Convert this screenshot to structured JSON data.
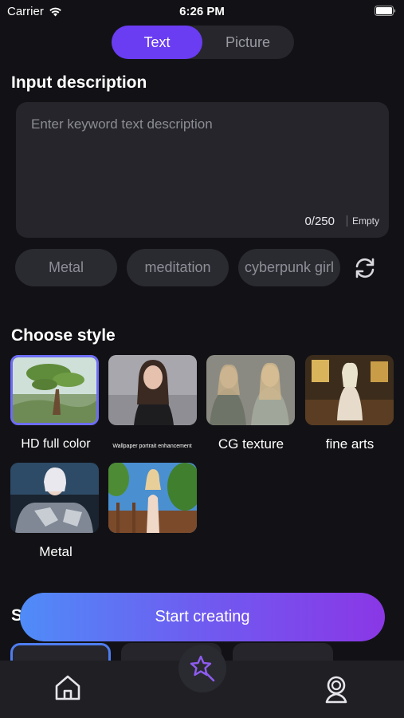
{
  "status": {
    "carrier": "Carrier",
    "time": "6:26 PM"
  },
  "mode_tabs": [
    {
      "label": "Text",
      "selected": true
    },
    {
      "label": "Picture",
      "selected": false
    }
  ],
  "input": {
    "title": "Input description",
    "placeholder": "Enter keyword text description",
    "counter": "0/250",
    "empty_label": "Empty"
  },
  "keyword_chips": [
    "Metal",
    "meditation",
    "cyberpunk girl"
  ],
  "style": {
    "title": "Choose style",
    "items": [
      {
        "label": "HD full color",
        "selected": true
      },
      {
        "label": "Wallpaper portrait enhancement",
        "selected": false
      },
      {
        "label": "CG texture",
        "selected": false
      },
      {
        "label": "fine arts",
        "selected": false
      },
      {
        "label": "Metal",
        "selected": false
      },
      {
        "label": "",
        "selected": false
      }
    ]
  },
  "cta_label": "Start creating",
  "partial_section_letter": "S",
  "colors": {
    "accent": "#6a3cf2",
    "background": "#121216",
    "card": "#25252b"
  },
  "tab_bar": [
    {
      "icon": "home-icon"
    },
    {
      "icon": "magic-wand-star-icon"
    },
    {
      "icon": "profile-icon"
    }
  ]
}
